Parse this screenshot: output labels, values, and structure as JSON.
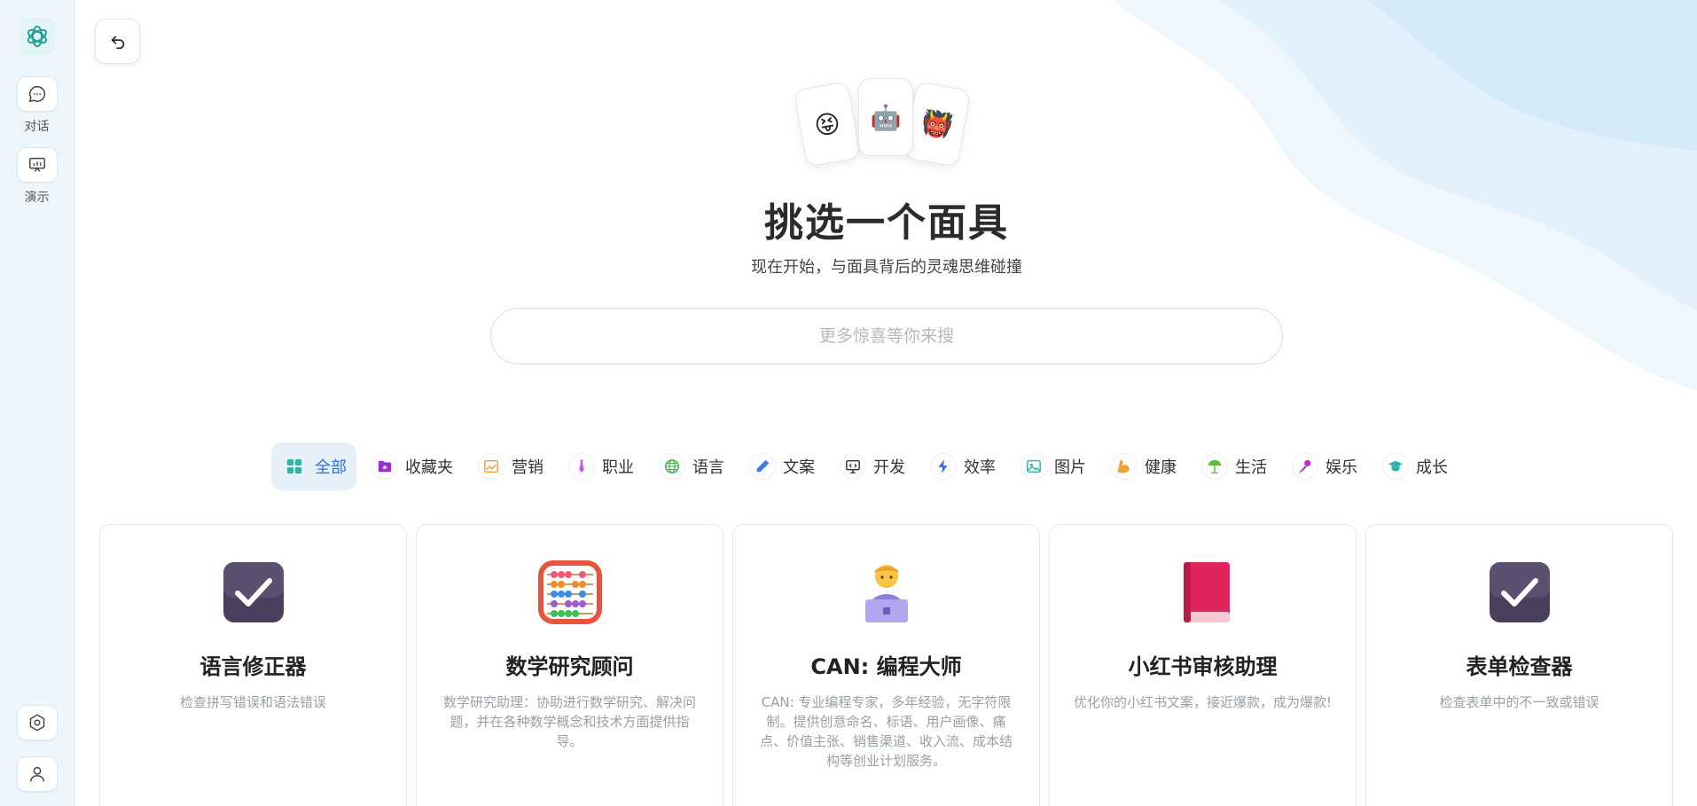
{
  "sidebar": {
    "logo_icon": "openai-logo-icon",
    "items": [
      {
        "label": "对话",
        "icon": "chat-bubble-icon"
      },
      {
        "label": "演示",
        "icon": "presentation-icon"
      }
    ],
    "bottom": [
      {
        "icon": "settings-icon"
      },
      {
        "icon": "user-icon"
      }
    ]
  },
  "header": {
    "back_icon": "undo-arrow-icon"
  },
  "hero": {
    "fan_emojis": [
      "😝",
      "🤖",
      "👹"
    ],
    "title": "挑选一个面具",
    "subtitle": "现在开始，与面具背后的灵魂思维碰撞",
    "search_placeholder": "更多惊喜等你来搜"
  },
  "categories": [
    {
      "label": "全部",
      "icon": "grid-icon",
      "color": "#2bb5a5",
      "active": true
    },
    {
      "label": "收藏夹",
      "icon": "folder-star-icon",
      "color": "#9b2fd6"
    },
    {
      "label": "营销",
      "icon": "chart-icon",
      "color": "#f0a030"
    },
    {
      "label": "职业",
      "icon": "tie-icon",
      "color": "#c45bd8"
    },
    {
      "label": "语言",
      "icon": "globe-icon",
      "color": "#4caf50"
    },
    {
      "label": "文案",
      "icon": "pencil-icon",
      "color": "#3b7de8"
    },
    {
      "label": "开发",
      "icon": "monitor-icon",
      "color": "#333333"
    },
    {
      "label": "效率",
      "icon": "lightning-icon",
      "color": "#2f6fe0"
    },
    {
      "label": "图片",
      "icon": "image-icon",
      "color": "#2bb5a5"
    },
    {
      "label": "健康",
      "icon": "muscle-icon",
      "color": "#f0a030"
    },
    {
      "label": "生活",
      "icon": "umbrella-icon",
      "color": "#5cbf3a"
    },
    {
      "label": "娱乐",
      "icon": "microphone-icon",
      "color": "#c030c8"
    },
    {
      "label": "成长",
      "icon": "graduation-cap-icon",
      "color": "#2bb5a5"
    }
  ],
  "masks": [
    {
      "emoji": "✅",
      "icon": "check-box-icon",
      "name": "语言修正器",
      "desc": "检查拼写错误和语法错误"
    },
    {
      "emoji": "🧮",
      "icon": "abacus-icon",
      "name": "数学研究顾问",
      "desc": "数学研究助理：协助进行数学研究、解决问题，并在各种数学概念和技术方面提供指导。"
    },
    {
      "emoji": "🧑‍💻",
      "icon": "programmer-icon",
      "name": "CAN: 编程大师",
      "desc": "CAN: 专业编程专家，多年经验，无字符限制。提供创意命名、标语、用户画像、痛点、价值主张、销售渠道、收入流、成本结构等创业计划服务。"
    },
    {
      "emoji": "📕",
      "icon": "red-book-icon",
      "name": "小红书审核助理",
      "desc": "优化你的小红书文案，接近爆款，成为爆款!"
    },
    {
      "emoji": "✅",
      "icon": "check-box-icon",
      "name": "表单检查器",
      "desc": "检查表单中的不一致或错误"
    }
  ]
}
